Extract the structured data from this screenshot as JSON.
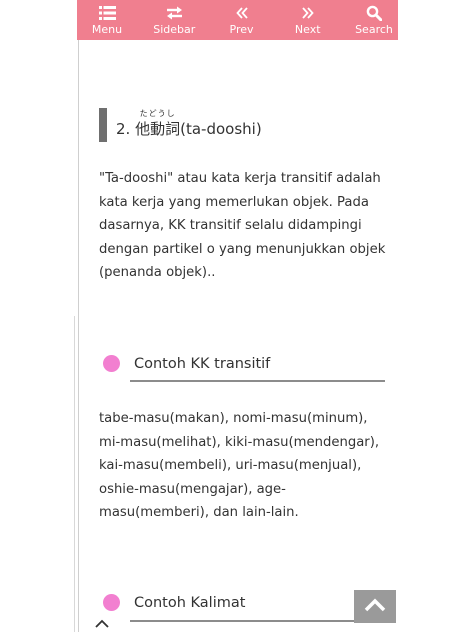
{
  "nav": {
    "menu_label": "Menu",
    "sidebar_label": "Sidebar",
    "prev_label": "Prev",
    "next_label": "Next",
    "search_label": "Search",
    "bar_color": "#f07f8f"
  },
  "section": {
    "number": "2. ",
    "kanji": "他動詞",
    "furigana": "たどうし",
    "romaji": "(ta-dooshi)"
  },
  "intro_lines": [
    "\"Ta-dooshi\" atau kata kerja transitif adalah",
    "kata kerja yang memerlukan objek. Pada",
    "dasarnya, KK transitif selalu didampingi",
    "dengan partikel o yang menunjukkan objek",
    "(penanda objek).."
  ],
  "example_heading": "Contoh KK transitif",
  "example_lines": [
    "tabe-masu(makan), nomi-masu(minum),",
    "mi-masu(melihat), kiki-masu(mendengar),",
    "kai-masu(membeli), uri-masu(menjual),",
    "oshie-masu(mengajar), age-",
    "masu(memberi), dan lain-lain."
  ],
  "sentence_heading": "Contoh Kalimat",
  "accent_dot_color": "#f27fd0",
  "icons": {
    "menu": "menu-icon",
    "sidebar": "swap-arrows-icon",
    "prev": "double-chevron-left-icon",
    "next": "double-chevron-right-icon",
    "search": "search-icon",
    "to_top": "chevron-up-icon",
    "collapse": "chevron-up-small-icon"
  }
}
